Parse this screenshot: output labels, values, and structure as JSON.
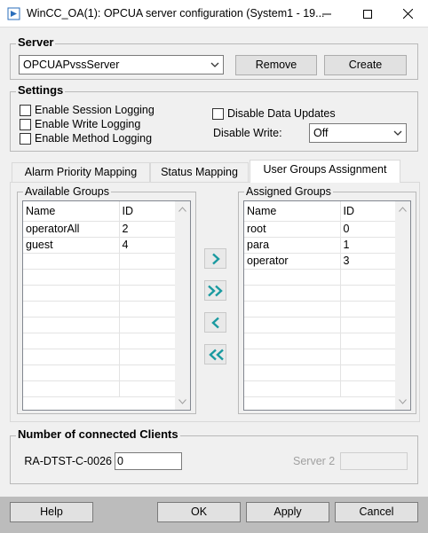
{
  "window": {
    "title": "WinCC_OA(1): OPCUA server configuration (System1 - 19...",
    "minimize_icon": "minimize-icon",
    "maximize_icon": "maximize-icon",
    "close_icon": "close-icon"
  },
  "server": {
    "group_title": "Server",
    "selected": "OPCUAPvssServer",
    "remove_label": "Remove",
    "create_label": "Create"
  },
  "settings": {
    "group_title": "Settings",
    "enable_session_logging": "Enable Session Logging",
    "enable_write_logging": "Enable Write Logging",
    "enable_method_logging": "Enable Method Logging",
    "disable_data_updates": "Disable Data Updates",
    "disable_write_label": "Disable Write:",
    "disable_write_value": "Off"
  },
  "tabs": [
    {
      "label": "Alarm Priority Mapping"
    },
    {
      "label": "Status Mapping"
    },
    {
      "label": "User Groups Assignment"
    }
  ],
  "available_groups": {
    "title": "Available Groups",
    "headers": {
      "name": "Name",
      "id": "ID"
    },
    "rows": [
      {
        "name": "operatorAll",
        "id": "2"
      },
      {
        "name": "guest",
        "id": "4"
      }
    ]
  },
  "assigned_groups": {
    "title": "Assigned Groups",
    "headers": {
      "name": "Name",
      "id": "ID"
    },
    "rows": [
      {
        "name": "root",
        "id": "0"
      },
      {
        "name": "para",
        "id": "1"
      },
      {
        "name": "operator",
        "id": "3"
      }
    ]
  },
  "clients": {
    "group_title": "Number of connected Clients",
    "server1_label": "RA-DTST-C-0026",
    "server1_value": "0",
    "server2_label": "Server 2",
    "server2_value": ""
  },
  "footer": {
    "help": "Help",
    "ok": "OK",
    "apply": "Apply",
    "cancel": "Cancel"
  },
  "colors": {
    "move_arrow": "#1a9aa0",
    "bottom_bar": "#bcbcbc"
  }
}
